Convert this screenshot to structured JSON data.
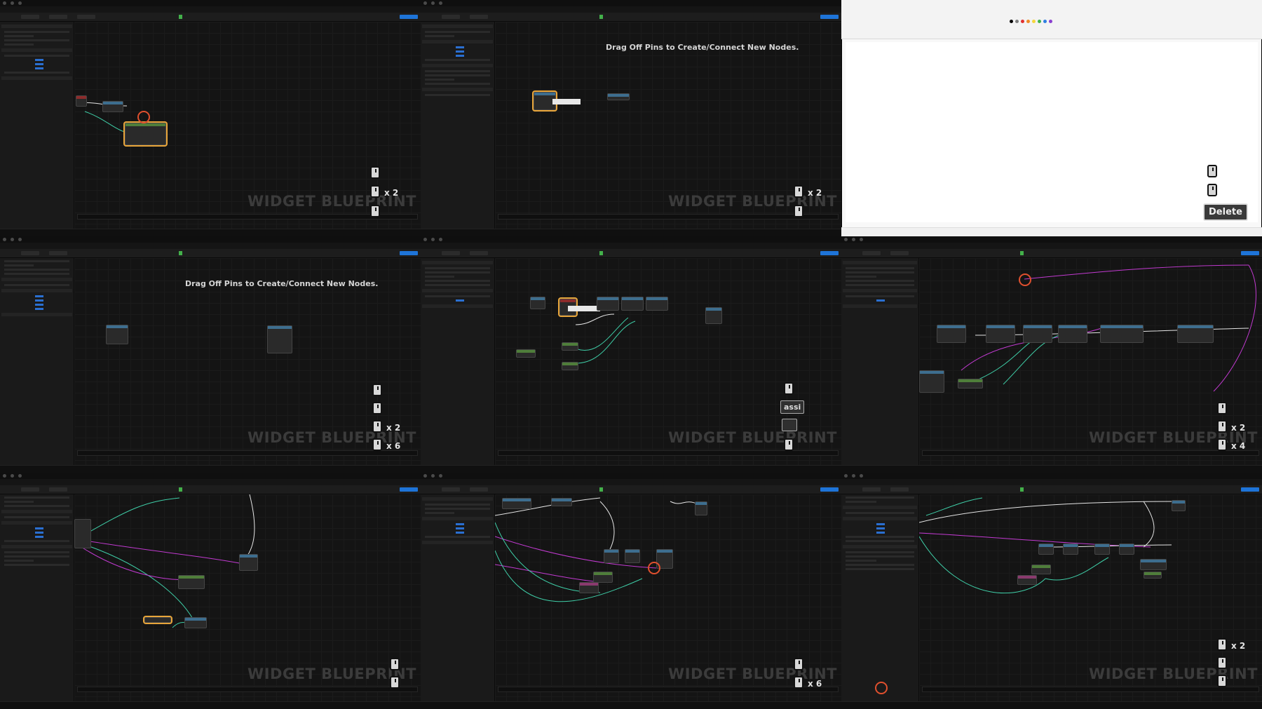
{
  "watermark": "WIDGET BLUEPRINT",
  "hint_text": "Drag Off Pins to Create/Connect New Nodes.",
  "delete_key": "Delete",
  "assist_key": "assi",
  "multipliers": {
    "x2": "x 2",
    "x4": "x 4",
    "x6": "x 6"
  },
  "colors": {
    "editor_bg": "#141414",
    "wire_exec": "#e6e6e6",
    "wire_pink": "#c23ad1",
    "wire_teal": "#3fcfa8",
    "selection": "#e8a53a",
    "click_ring": "#e0502e",
    "accent_blue": "#1e74d8"
  },
  "icons": [
    "mouse-icon",
    "play-icon",
    "click-indicator-icon"
  ]
}
